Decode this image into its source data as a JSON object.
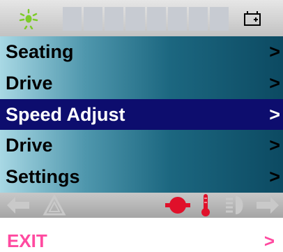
{
  "topbar": {
    "lights_icon": "lights-icon",
    "battery_segments": 8,
    "battery_icon": "battery-icon"
  },
  "menu": {
    "items": [
      {
        "label": "Seating",
        "arrow": ">",
        "selected": false
      },
      {
        "label": "Drive",
        "arrow": ">",
        "selected": false
      },
      {
        "label": "Speed Adjust",
        "arrow": ">",
        "selected": true
      },
      {
        "label": "Drive",
        "arrow": ">",
        "selected": false
      },
      {
        "label": "Settings",
        "arrow": ">",
        "selected": false
      }
    ]
  },
  "statusbar": {
    "icons": [
      "left-arrow-icon",
      "hazard-icon",
      "brake-icon",
      "thermometer-icon",
      "headlight-icon",
      "right-arrow-icon"
    ]
  },
  "exit": {
    "label": "EXIT",
    "arrow": ">"
  },
  "colors": {
    "selected_bg": "#0d0d6e",
    "exit_color": "#ff4aa0",
    "light_icon": "#7ecb2a",
    "alert_red": "#e0102a"
  }
}
